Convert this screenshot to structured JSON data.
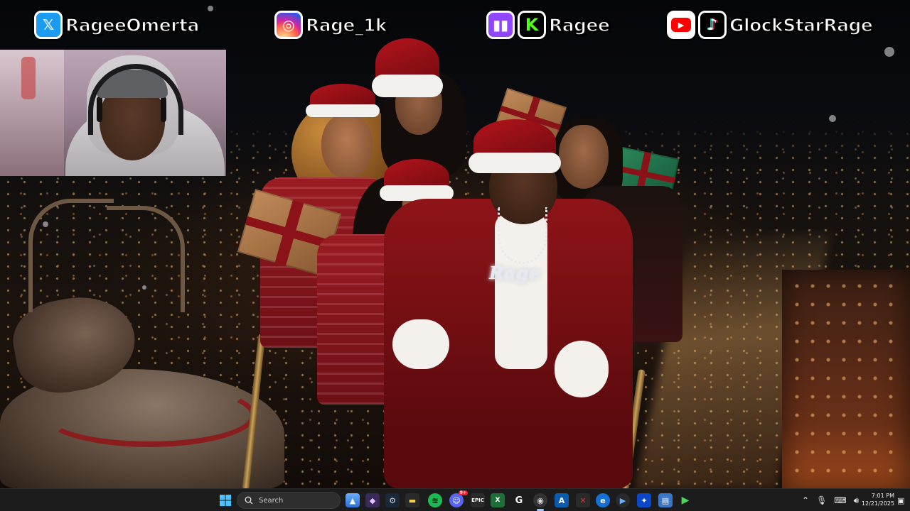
{
  "overlay": {
    "twitter_handle": "RageeOmerta",
    "instagram_handle": "Rage_1k",
    "twitch_kick_handle": "Ragee",
    "youtube_tiktok_handle": "GlockStarRage"
  },
  "scene": {
    "pendant_text": "Rage"
  },
  "taskbar": {
    "search_label": "Search",
    "time": "7:01 PM",
    "date": "12/21/2025",
    "discord_badge": "9+"
  },
  "colors": {
    "twitter": "#1d9bf0",
    "instagram": "#d6249f",
    "twitch": "#9146ff",
    "kick": "#53fc18",
    "youtube": "#ff0000",
    "tiktok": "#000000",
    "taskbar": "#1c1c1c"
  },
  "icons": {
    "twitter": "twitter-x-icon",
    "instagram": "instagram-icon",
    "twitch": "twitch-icon",
    "kick": "kick-icon",
    "youtube": "youtube-icon",
    "tiktok": "tiktok-icon"
  }
}
